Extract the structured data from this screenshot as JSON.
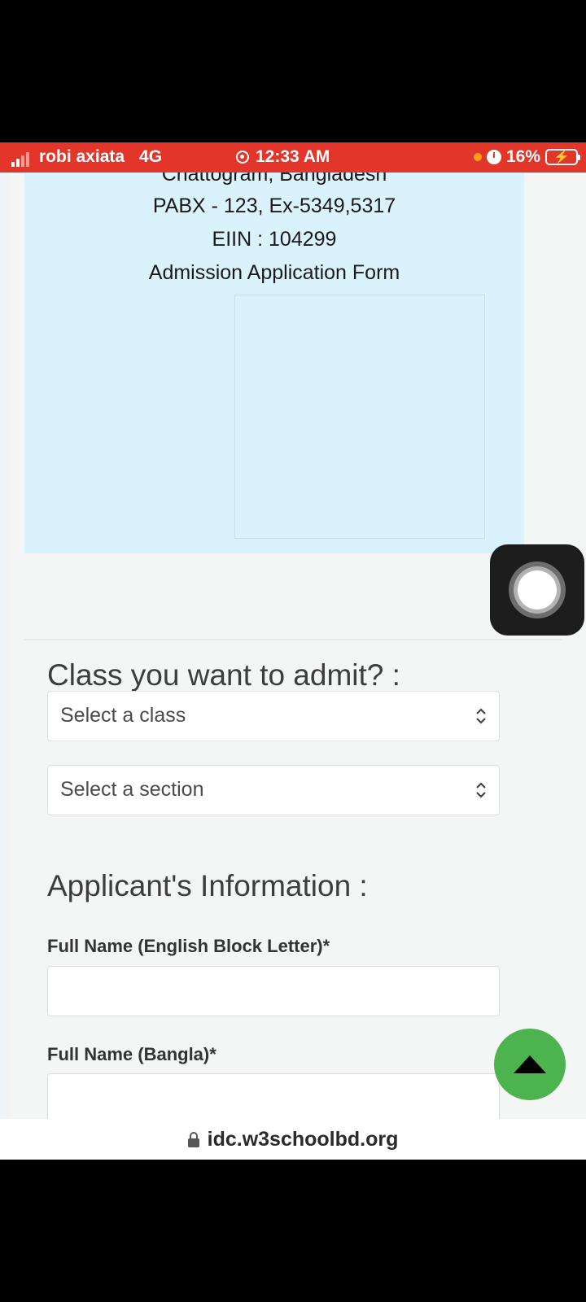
{
  "status_bar": {
    "carrier": "robi axiata",
    "network": "4G",
    "time": "12:33 AM",
    "battery": "16%",
    "background_color": "#e3362b"
  },
  "header": {
    "line0": "Chattogram, Bangladesh",
    "line1": "PABX - 123, Ex-5349,5317",
    "line2": "EIIN : 104299",
    "line3": "Admission Application Form",
    "background_color": "#d9f2fb"
  },
  "class_section": {
    "title": "Class you want to admit? :",
    "class_select": {
      "value": "Select a class"
    },
    "section_select": {
      "value": "Select a section"
    }
  },
  "applicant_section": {
    "title": "Applicant's Information :",
    "full_name_english": {
      "label": "Full Name (English Block Letter)*",
      "value": ""
    },
    "full_name_bangla": {
      "label": "Full Name (Bangla)*",
      "value": ""
    }
  },
  "floating": {
    "assistive_touch_icon": "assistive-touch-icon",
    "scroll_top_icon": "arrow-up-icon",
    "scroll_top_color": "#4db34f"
  },
  "url_bar": {
    "url": "idc.w3schoolbd.org",
    "icon": "lock-icon"
  }
}
